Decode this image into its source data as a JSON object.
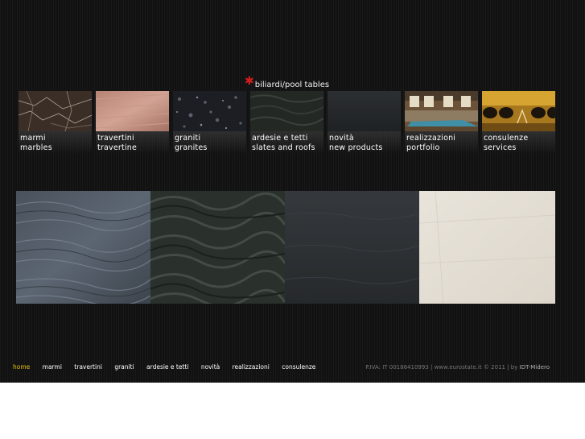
{
  "pool_link": {
    "label": "biliardi/pool tables"
  },
  "categories": [
    {
      "it": "marmi",
      "en": "marbles"
    },
    {
      "it": "travertini",
      "en": "travertine"
    },
    {
      "it": "graniti",
      "en": "granites"
    },
    {
      "it": "ardesie  e tetti",
      "en": "slates and roofs"
    },
    {
      "it": "novità",
      "en": "new products"
    },
    {
      "it": "realizzazioni",
      "en": "portfolio"
    },
    {
      "it": "consulenze",
      "en": "services"
    }
  ],
  "footer_nav": [
    "home",
    "marmi",
    "travertini",
    "graniti",
    "ardesie e tetti",
    "novità",
    "realizzazioni",
    "consulenze"
  ],
  "footer_nav_active": "home",
  "footer_info": {
    "text": "P.IVA: IT 00186410993 | www.eurostate.it © 2011 | by",
    "credit": "IDT-Midero"
  },
  "colors": {
    "background": "#111111",
    "accent_star": "#d41e1e",
    "active_nav": "#e8c10a",
    "footer_text": "#777777"
  }
}
